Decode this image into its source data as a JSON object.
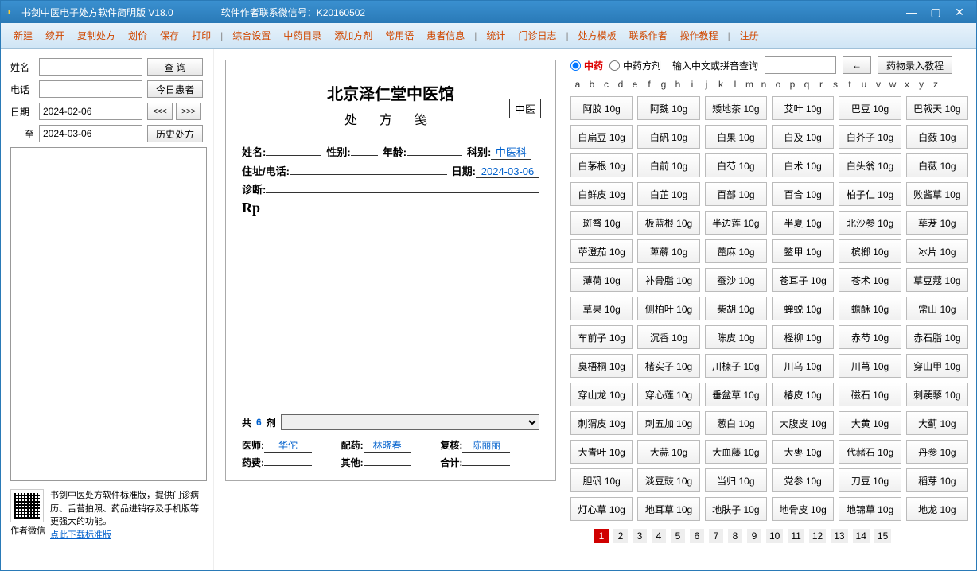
{
  "titlebar": {
    "title": "书剑中医电子处方软件简明版    V18.0",
    "contact": "软件作者联系微信号：K20160502"
  },
  "menu": [
    "新建",
    "续开",
    "复制处方",
    "划价",
    "保存",
    "打印",
    "|",
    "综合设置",
    "中药目录",
    "添加方剂",
    "常用语",
    "患者信息",
    "|",
    "统计",
    "门诊日志",
    "|",
    "处方模板",
    "联系作者",
    "操作教程",
    "|",
    "注册"
  ],
  "left": {
    "name_label": "姓名",
    "phone_label": "电话",
    "date_label": "日期",
    "to_label": "至",
    "query_btn": "查    询",
    "today_btn": "今日患者",
    "prev_btn": "<<<",
    "next_btn": ">>>",
    "history_btn": "历史处方",
    "date_from": "2024-02-06",
    "date_to": "2024-03-06",
    "qr_label": "作者微信",
    "promo": "书剑中医处方软件标准版，提供门诊病历、舌苔拍照、药品进销存及手机版等更强大的功能。",
    "promo_link": "点此下载标准版"
  },
  "rx": {
    "hospital": "北京泽仁堂中医馆",
    "subtitle": "处 方 笺",
    "type_tab": "中医",
    "fields": {
      "name": "姓名:",
      "gender": "性别:",
      "age": "年龄:",
      "dept": "科别:",
      "dept_value": "中医科",
      "addr": "住址/电话:",
      "date": "日期:",
      "date_value": "2024-03-06",
      "diag": "诊断:"
    },
    "rp": "Rp",
    "dose_row": {
      "prefix": "共",
      "count": "6",
      "suffix": "剂"
    },
    "signs": {
      "doctor": "医师:",
      "doctor_val": "华佗",
      "pharma": "配药:",
      "pharma_val": "林晓春",
      "check": "复核:",
      "check_val": "陈丽丽",
      "fee": "药费:",
      "other": "其他:",
      "total": "合计:"
    }
  },
  "right": {
    "radio_herb": "中药",
    "radio_formula": "中药方剂",
    "search_label": "输入中文或拼音查询",
    "back_btn": "←",
    "tutorial_btn": "药物录入教程",
    "alphabet": [
      "a",
      "b",
      "c",
      "d",
      "e",
      "f",
      "g",
      "h",
      "i",
      "j",
      "k",
      "l",
      "m",
      "n",
      "o",
      "p",
      "q",
      "r",
      "s",
      "t",
      "u",
      "v",
      "w",
      "x",
      "y",
      "z"
    ],
    "herbs": [
      "阿胶 10g",
      "阿魏 10g",
      "矮地茶 10g",
      "艾叶 10g",
      "巴豆 10g",
      "巴戟天 10g",
      "白扁豆 10g",
      "白矾 10g",
      "白果 10g",
      "白及 10g",
      "白芥子 10g",
      "白蔹 10g",
      "白茅根 10g",
      "白前 10g",
      "白芍 10g",
      "白术 10g",
      "白头翁 10g",
      "白薇 10g",
      "白鲜皮 10g",
      "白芷 10g",
      "百部 10g",
      "百合 10g",
      "柏子仁 10g",
      "败酱草 10g",
      "斑蝥 10g",
      "板蓝根 10g",
      "半边莲 10g",
      "半夏 10g",
      "北沙参 10g",
      "荜茇 10g",
      "荜澄茄 10g",
      "萆薢 10g",
      "蓖麻 10g",
      "鳖甲 10g",
      "槟榔 10g",
      "冰片 10g",
      "薄荷 10g",
      "补骨脂 10g",
      "蚕沙 10g",
      "苍耳子 10g",
      "苍术 10g",
      "草豆蔻 10g",
      "草果 10g",
      "侧柏叶 10g",
      "柴胡 10g",
      "蝉蜕 10g",
      "蟾酥 10g",
      "常山 10g",
      "车前子 10g",
      "沉香 10g",
      "陈皮 10g",
      "柽柳 10g",
      "赤芍 10g",
      "赤石脂 10g",
      "臭梧桐 10g",
      "楮实子 10g",
      "川楝子 10g",
      "川乌 10g",
      "川芎 10g",
      "穿山甲 10g",
      "穿山龙 10g",
      "穿心莲 10g",
      "垂盆草 10g",
      "椿皮 10g",
      "磁石 10g",
      "刺蒺藜 10g",
      "刺猬皮 10g",
      "刺五加 10g",
      "葱白 10g",
      "大腹皮 10g",
      "大黄 10g",
      "大蓟 10g",
      "大青叶 10g",
      "大蒜 10g",
      "大血藤 10g",
      "大枣 10g",
      "代赭石 10g",
      "丹参 10g",
      "胆矾 10g",
      "淡豆豉 10g",
      "当归 10g",
      "党参 10g",
      "刀豆 10g",
      "稻芽 10g",
      "灯心草 10g",
      "地耳草 10g",
      "地肤子 10g",
      "地骨皮 10g",
      "地锦草 10g",
      "地龙 10g"
    ],
    "pages": [
      "1",
      "2",
      "3",
      "4",
      "5",
      "6",
      "7",
      "8",
      "9",
      "10",
      "11",
      "12",
      "13",
      "14",
      "15"
    ],
    "active_page": "1"
  }
}
